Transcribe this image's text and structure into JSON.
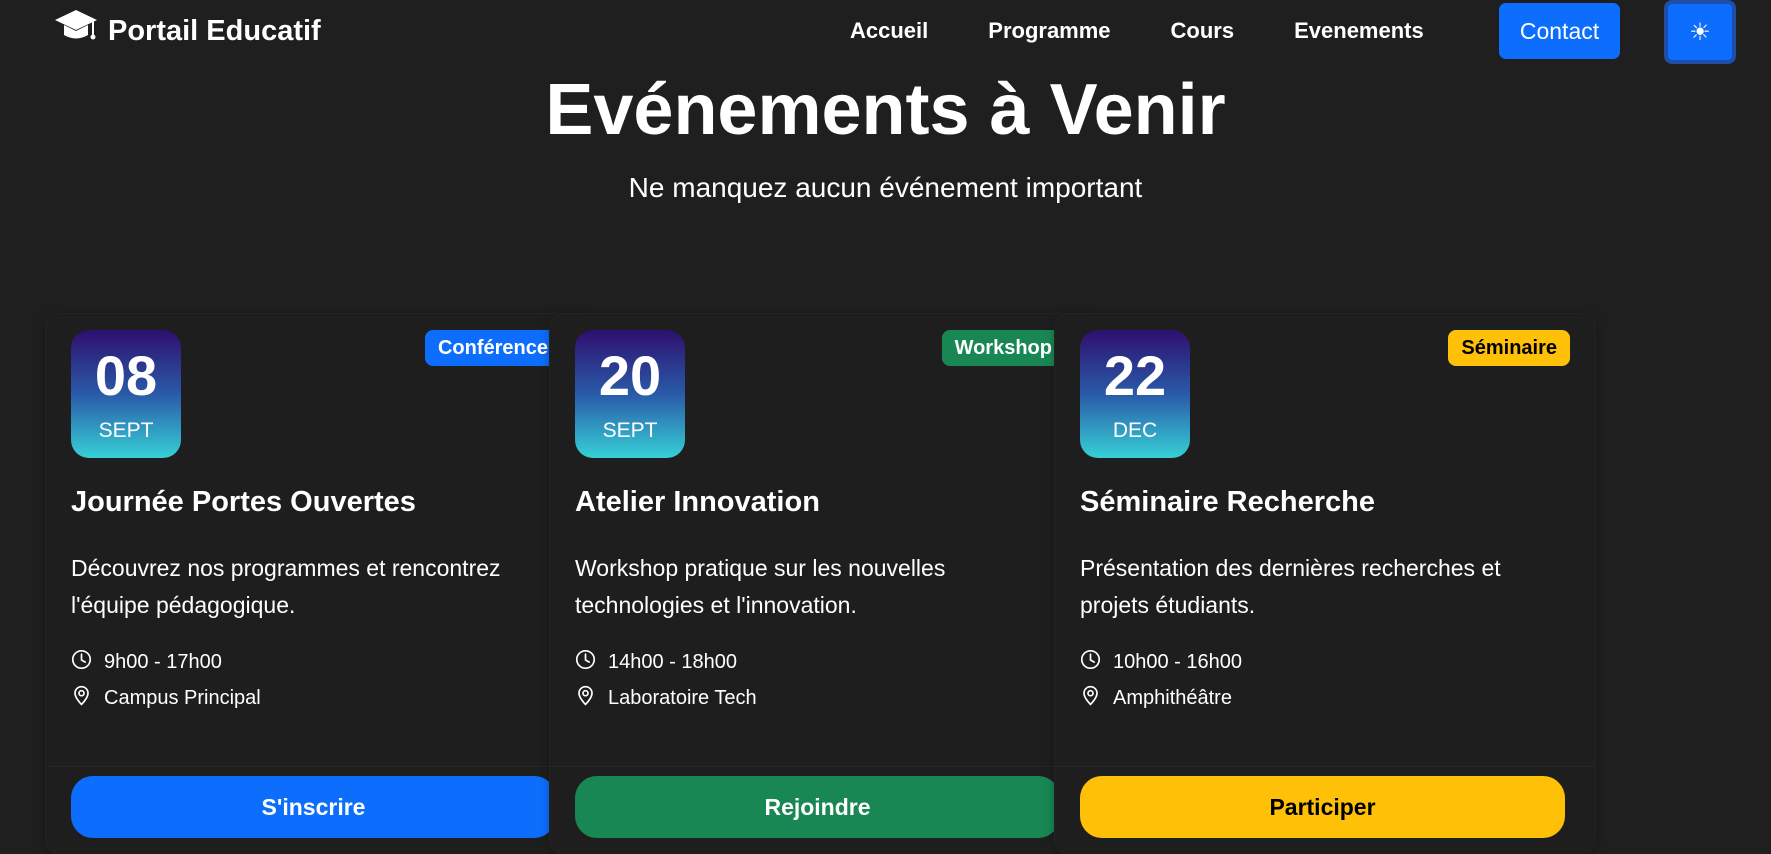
{
  "navbar": {
    "brand": "Portail Educatif",
    "brand_icon": "graduation-cap-icon",
    "links": [
      {
        "label": "Accueil"
      },
      {
        "label": "Programme"
      },
      {
        "label": "Cours"
      },
      {
        "label": "Evenements"
      }
    ],
    "contact_label": "Contact",
    "theme_icon": "☀",
    "accent_color": "#0d6efd"
  },
  "hero": {
    "title": "Evénements à Venir",
    "subtitle": "Ne manquez aucun événement important"
  },
  "events": [
    {
      "day": "08",
      "month": "SEPT",
      "badge": "Conférence",
      "badge_color": "#0d6efd",
      "badge_text_color": "#ffffff",
      "title": "Journée Portes Ouvertes",
      "description": "Découvrez nos programmes et rencontrez l'équipe pédagogique.",
      "time": "9h00 - 17h00",
      "location": "Campus Principal",
      "cta": "S'inscrire",
      "cta_color": "#0d6efd",
      "cta_text_color": "#ffffff"
    },
    {
      "day": "20",
      "month": "SEPT",
      "badge": "Workshop",
      "badge_color": "#198754",
      "badge_text_color": "#ffffff",
      "title": "Atelier Innovation",
      "description": "Workshop pratique sur les nouvelles technologies et l'innovation.",
      "time": "14h00 - 18h00",
      "location": "Laboratoire Tech",
      "cta": "Rejoindre",
      "cta_color": "#198754",
      "cta_text_color": "#ffffff"
    },
    {
      "day": "22",
      "month": "DEC",
      "badge": "Séminaire",
      "badge_color": "#ffc107",
      "badge_text_color": "#000000",
      "title": "Séminaire Recherche",
      "description": "Présentation des dernières recherches et projets étudiants.",
      "time": "10h00 - 16h00",
      "location": "Amphithéâtre",
      "cta": "Participer",
      "cta_color": "#ffc107",
      "cta_text_color": "#000000"
    }
  ]
}
